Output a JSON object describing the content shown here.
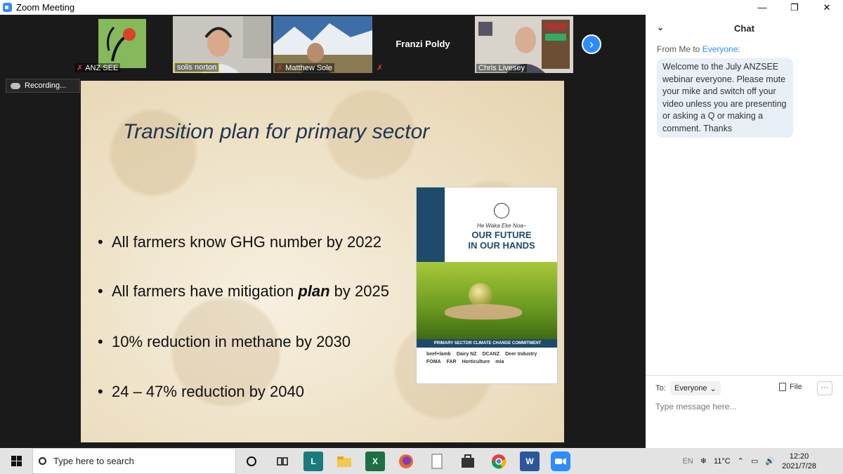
{
  "window": {
    "title": "Zoom Meeting",
    "minimize": "—",
    "restore": "❐",
    "close": "✕"
  },
  "participants": [
    {
      "name": "ANZ SEE"
    },
    {
      "name": "solis norton"
    },
    {
      "name": "Matthew Sole"
    },
    {
      "name": "Franzi Poldy"
    },
    {
      "name": "Chris Livesey"
    }
  ],
  "next_glyph": "›",
  "recording": {
    "label": "Recording..."
  },
  "slide": {
    "title": "Transition plan for primary sector",
    "bullets": [
      {
        "pre": "All farmers know GHG number by 2022",
        "bold": "",
        "post": ""
      },
      {
        "pre": "All farmers have mitigation ",
        "bold": "plan",
        "post": " by 2025"
      },
      {
        "pre": "10% reduction in methane by 2030",
        "bold": "",
        "post": ""
      },
      {
        "pre": "24 – 47% reduction by 2040",
        "bold": "",
        "post": ""
      }
    ],
    "cover": {
      "subtitle": "He Waka Eke Noa–",
      "title_line1": "OUR FUTURE",
      "title_line2": "IN OUR HANDS",
      "band": "PRIMARY SECTOR CLIMATE CHANGE COMMITMENT",
      "logos": [
        "beef+lamb",
        "Dairy NZ",
        "DCANZ",
        "Deer Industry",
        "FOMA",
        "FAR",
        "Horticulture",
        "mia"
      ]
    }
  },
  "chat": {
    "header": "Chat",
    "collapse_glyph": "⌄",
    "from_prefix": "From Me to ",
    "from_target": "Everyone",
    "from_suffix": ":",
    "message": "Welcome to the July ANZSEE webinar everyone.  Please mute your mike and switch off your video unless you are presenting or asking a Q or making a comment.  Thanks",
    "to_label": "To:",
    "to_value": "Everyone",
    "file_label": "File",
    "more_glyph": "···",
    "input_placeholder": "Type message here..."
  },
  "taskbar": {
    "search_placeholder": "Type here to search",
    "icons": [
      "cortana-icon",
      "task-view-icon",
      "l-app-icon",
      "file-explorer-icon",
      "excel-icon",
      "firefox-icon",
      "notepad-icon",
      "store-icon",
      "chrome-icon",
      "word-icon",
      "zoom-icon"
    ],
    "lang": "EN",
    "temperature": "11°C",
    "time": "12:20",
    "date": "2021/7/28"
  },
  "colors": {
    "zoom_blue": "#2d8cff",
    "slide_title": "#1f3552",
    "chat_bubble": "#e9eff7"
  }
}
